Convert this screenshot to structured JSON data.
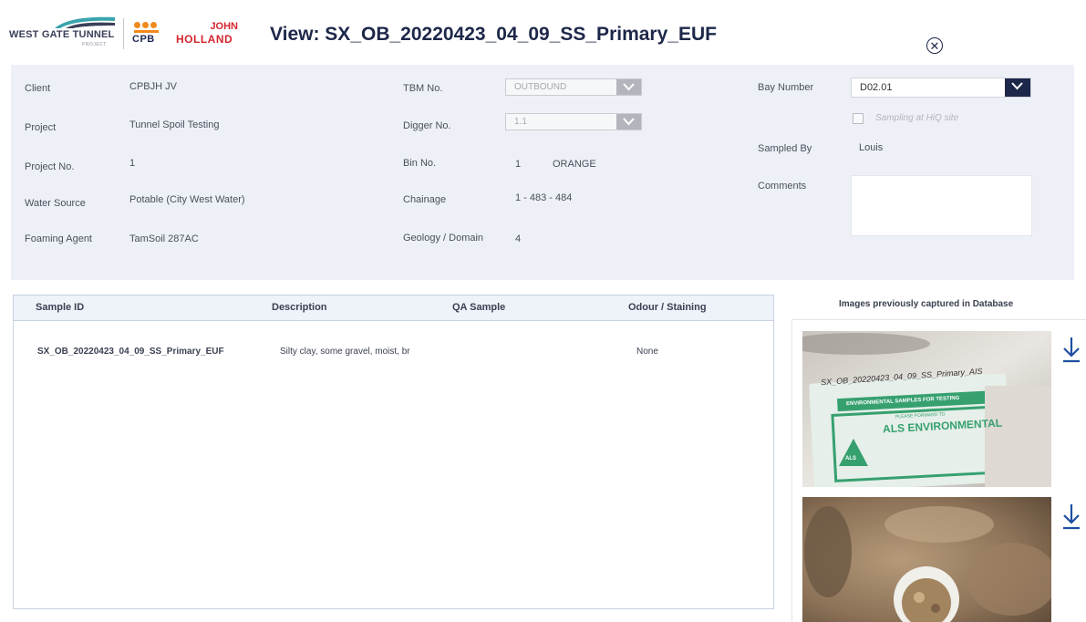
{
  "header": {
    "logos": {
      "wgt_text": "WEST GATE TUNNEL",
      "wgt_sub": "PROJECT",
      "cpb_text": "CPB",
      "jh_line1": "JOHN",
      "jh_line2": "HOLLAND"
    },
    "title": "View: SX_OB_20220423_04_09_SS_Primary_EUF",
    "close_icon": "close-circle-icon"
  },
  "info": {
    "client_label": "Client",
    "client_value": "CPBJH JV",
    "project_label": "Project",
    "project_value": "Tunnel Spoil Testing",
    "project_no_label": "Project No.",
    "project_no_value": "1",
    "water_source_label": "Water Source",
    "water_source_value": "Potable (City West Water)",
    "foaming_agent_label": "Foaming Agent",
    "foaming_agent_value": "TamSoil 287AC",
    "tbm_label": "TBM No.",
    "tbm_value": "OUTBOUND",
    "digger_label": "Digger No.",
    "digger_value": "1.1",
    "bin_label": "Bin No.",
    "bin_value": "1",
    "bin_color": "ORANGE",
    "chainage_label": "Chainage",
    "chainage_value": "1 - 483 - 484",
    "geology_label": "Geology / Domain",
    "geology_value": "4",
    "bay_label": "Bay Number",
    "bay_value": "D02.01",
    "sampling_label": "Sampling at HiQ site",
    "sampling_checked": false,
    "sampled_by_label": "Sampled By",
    "sampled_by_value": "Louis",
    "comments_label": "Comments",
    "comments_value": ""
  },
  "table": {
    "columns": [
      "Sample ID",
      "Description",
      "QA Sample",
      "Odour / Staining"
    ],
    "rows": [
      [
        "SX_OB_20220423_04_09_SS_Primary_EUF",
        "Silty clay, some gravel, moist, br",
        "",
        "None"
      ]
    ]
  },
  "images": {
    "header": "Images previously captured in Database",
    "items": [
      {
        "handwriting": "SX_OB_20220423_04_09_SS_Primary_AIS",
        "label_title": "ENVIRONMENTAL SAMPLES FOR TESTING",
        "label_please": "PLEASE FORWARD TO",
        "label_company": "ALS ENVIRONMENTAL",
        "label_logo": "ALS",
        "download_icon": "download-icon"
      },
      {
        "download_icon": "download-icon"
      }
    ]
  },
  "colors": {
    "navy": "#1d2749",
    "panel_bg": "#edf0f6",
    "logo_red": "#d4262e",
    "logo_orange": "#f08a1d",
    "accent_teal": "#3aa3ad"
  }
}
